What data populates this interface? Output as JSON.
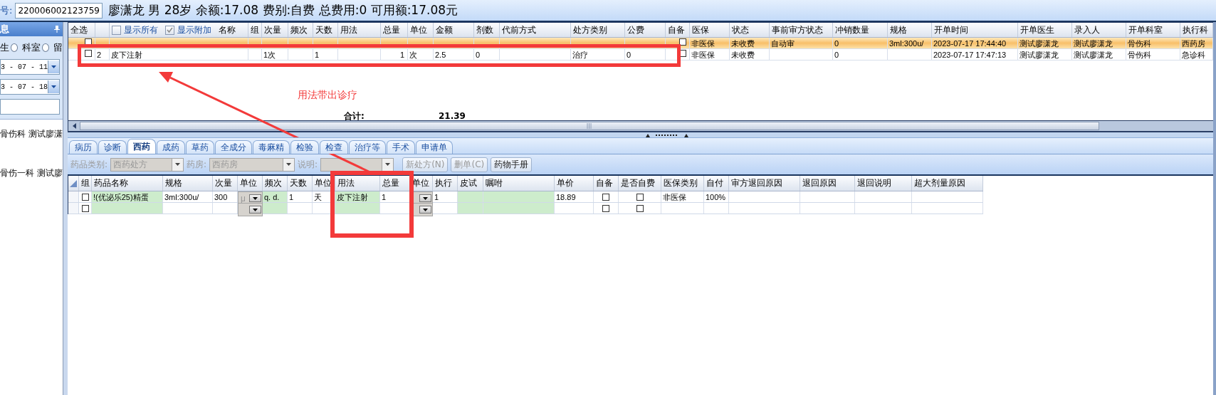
{
  "header": {
    "id_label": "号:",
    "card_number": "220006002123759",
    "patient_info": "廖潇龙 男 28岁 余额:17.08 费别:自费 总费用:0 可用额:17.08元"
  },
  "side_panel": {
    "title": "息",
    "filters": [
      {
        "label": "生",
        "selected": false
      },
      {
        "label": "科室",
        "selected": false
      },
      {
        "label": "留"
      }
    ],
    "date_from": "3 - 07 - 11",
    "date_to": "3 - 07 - 18",
    "records": [
      "骨伤科 测试廖潇",
      "骨伤一科 测试廖"
    ]
  },
  "top_grid": {
    "options": [
      {
        "label": "显示所有",
        "checked": false
      },
      {
        "label": "显示附加",
        "checked": true
      }
    ],
    "columns": [
      {
        "label": "全选",
        "kind": "check"
      },
      {
        "kind": "text"
      },
      {
        "label": "名称",
        "kind": "text"
      },
      {
        "label": "组",
        "kind": "text"
      },
      {
        "label": "次量",
        "kind": "text"
      },
      {
        "label": "频次",
        "kind": "text"
      },
      {
        "label": "天数",
        "kind": "text"
      },
      {
        "label": "用法",
        "kind": "text"
      },
      {
        "label": "总量",
        "kind": "number"
      },
      {
        "label": "单位",
        "kind": "text"
      },
      {
        "label": "金额",
        "kind": "text"
      },
      {
        "label": "剂数",
        "kind": "text"
      },
      {
        "label": "代前方式",
        "kind": "text"
      },
      {
        "label": "处方类别",
        "kind": "text"
      },
      {
        "label": "公费",
        "kind": "text"
      },
      {
        "label": "自备",
        "kind": "check"
      },
      {
        "label": "医保",
        "kind": "text"
      },
      {
        "label": "状态",
        "kind": "text"
      },
      {
        "label": "事前审方状态",
        "kind": "text"
      },
      {
        "label": "冲销数量",
        "kind": "text"
      },
      {
        "label": "规格",
        "kind": "text"
      },
      {
        "label": "开单时间",
        "kind": "text"
      },
      {
        "label": "开单医生",
        "kind": "text"
      },
      {
        "label": "录入人",
        "kind": "text"
      },
      {
        "label": "开单科室",
        "kind": "text"
      },
      {
        "label": "执行科",
        "kind": "text"
      }
    ],
    "rows": [
      {
        "selected": true,
        "cells": [
          {
            "checked": false
          },
          null,
          null,
          null,
          null,
          null,
          null,
          null,
          null,
          null,
          null,
          null,
          null,
          null,
          null,
          {
            "checked": false
          },
          "非医保",
          "未收费",
          "自动审",
          "0",
          "3ml:300u/",
          "2023-07-17 17:44:40",
          "测试廖潇龙",
          "测试廖潇龙",
          "骨伤科",
          "西药房"
        ]
      },
      {
        "selected": false,
        "cells": [
          {
            "checked": false
          },
          "2",
          "皮下注射",
          null,
          "1次",
          null,
          "1",
          null,
          "1",
          "次",
          "2.5",
          "0",
          null,
          "治疗",
          "0",
          {
            "checked": false
          },
          "非医保",
          "未收费",
          null,
          "0",
          null,
          "2023-07-17 17:47:13",
          "测试廖潇龙",
          "测试廖潇龙",
          "骨伤科",
          "急诊科"
        ]
      }
    ],
    "note": "用法带出诊疗",
    "total_label": "合计:",
    "total_amount": "21.39"
  },
  "tabs": [
    {
      "label": "病历",
      "selected": false
    },
    {
      "label": "诊断",
      "selected": false
    },
    {
      "label": "西药",
      "selected": true
    },
    {
      "label": "成药",
      "selected": false
    },
    {
      "label": "草药",
      "selected": false
    },
    {
      "label": "全成分",
      "selected": false
    },
    {
      "label": "毒麻精",
      "selected": false
    },
    {
      "label": "检验",
      "selected": false
    },
    {
      "label": "检查",
      "selected": false
    },
    {
      "label": "治疗等",
      "selected": false
    },
    {
      "label": "手术",
      "selected": false
    },
    {
      "label": "申请单",
      "selected": false
    }
  ],
  "toolbar": {
    "fields": [
      {
        "label": "药品类别:",
        "value": "西药处方",
        "disabled": true
      },
      {
        "label": "药房:",
        "value": "西药房",
        "disabled": true
      },
      {
        "label": "说明:",
        "disabled": true
      }
    ],
    "buttons": [
      {
        "label": "新处方(N)",
        "disabled": true
      },
      {
        "label": "删单(C)",
        "disabled": true
      },
      {
        "label": "药物手册",
        "disabled": false
      }
    ]
  },
  "drug_grid": {
    "columns": [
      {
        "label": "组",
        "kind": "check"
      },
      {
        "label": "药品名称",
        "kind": "input"
      },
      {
        "label": "规格",
        "kind": "text"
      },
      {
        "label": "次量",
        "kind": "text"
      },
      {
        "label": "单位",
        "kind": "combo"
      },
      {
        "label": "频次",
        "kind": "input"
      },
      {
        "label": "天数",
        "kind": "text"
      },
      {
        "label": "单位",
        "kind": "text"
      },
      {
        "label": "用法",
        "kind": "input"
      },
      {
        "label": "总量",
        "kind": "text"
      },
      {
        "label": "单位",
        "kind": "combo"
      },
      {
        "label": "执行",
        "kind": "text"
      },
      {
        "label": "皮试",
        "kind": "input"
      },
      {
        "label": "嘱咐",
        "kind": "input"
      },
      {
        "label": "单价",
        "kind": "text"
      },
      {
        "label": "自备",
        "kind": "check"
      },
      {
        "label": "是否自费",
        "kind": "check"
      },
      {
        "label": "医保类别",
        "kind": "text"
      },
      {
        "label": "自付",
        "kind": "text"
      },
      {
        "label": "审方退回原因",
        "kind": "text"
      },
      {
        "label": "退回原因",
        "kind": "text"
      },
      {
        "label": "退回说明",
        "kind": "text"
      },
      {
        "label": "超大剂量原因",
        "kind": "text"
      }
    ],
    "rows": [
      {
        "cells": [
          {
            "checked": false
          },
          "!(优泌乐25)精蛋",
          "3ml:300u/",
          "300",
          "μ",
          "q. d.",
          "1",
          "天",
          "皮下注射",
          "1",
          null,
          "1",
          null,
          null,
          "18.89",
          {
            "checked": false
          },
          {
            "checked": false
          },
          "非医保",
          "100%",
          null,
          null,
          null,
          null
        ]
      },
      {
        "cells": [
          {
            "checked": false
          },
          null,
          null,
          null,
          null,
          null,
          null,
          null,
          null,
          null,
          null,
          null,
          null,
          null,
          null,
          {
            "checked": false
          },
          {
            "checked": false
          },
          null,
          null,
          null,
          null,
          null,
          null
        ]
      }
    ]
  }
}
